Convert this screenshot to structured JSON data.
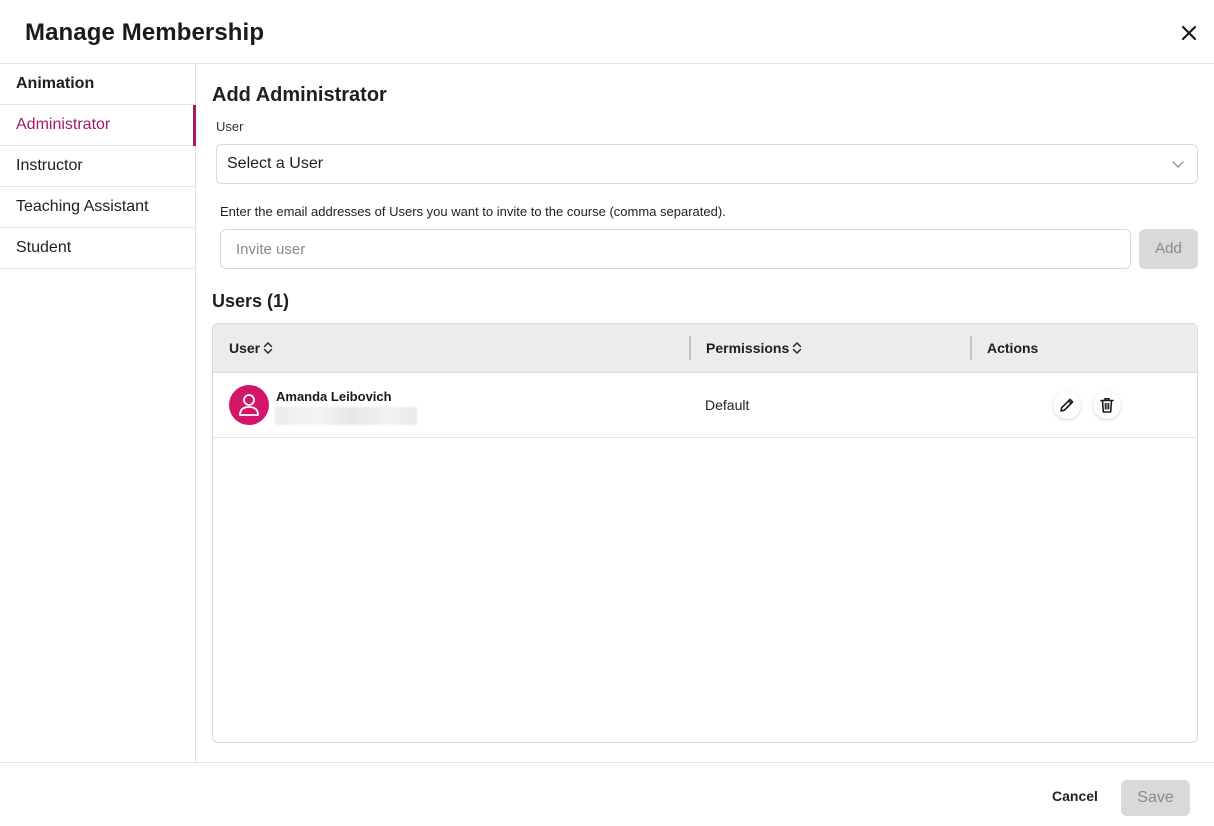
{
  "dialog": {
    "title": "Manage Membership"
  },
  "sidebar": {
    "items": [
      {
        "label": "Animation"
      },
      {
        "label": "Administrator"
      },
      {
        "label": "Instructor"
      },
      {
        "label": "Teaching Assistant"
      },
      {
        "label": "Student"
      }
    ],
    "selected": "Administrator"
  },
  "add_section": {
    "title": "Add Administrator",
    "user_label": "User",
    "select_value": "Select a User",
    "invite_help": "Enter the email addresses of Users you want to invite to the course (comma separated).",
    "invite_placeholder": "Invite user",
    "add_label": "Add"
  },
  "users": {
    "title": "Users (1)",
    "columns": [
      "User",
      "Permissions",
      "Actions"
    ],
    "rows": [
      {
        "name": "Amanda Leibovich",
        "permissions": "Default"
      }
    ]
  },
  "footer": {
    "cancel_label": "Cancel",
    "save_label": "Save"
  },
  "colors": {
    "accent": "#a31a62",
    "avatar": "#d4166b",
    "disabled_bg": "#d9d9d9",
    "header_bg": "#ececec"
  },
  "icons": [
    "close-icon",
    "chevron-down-icon",
    "sort-icon",
    "user-icon",
    "pencil-icon",
    "trash-icon"
  ]
}
